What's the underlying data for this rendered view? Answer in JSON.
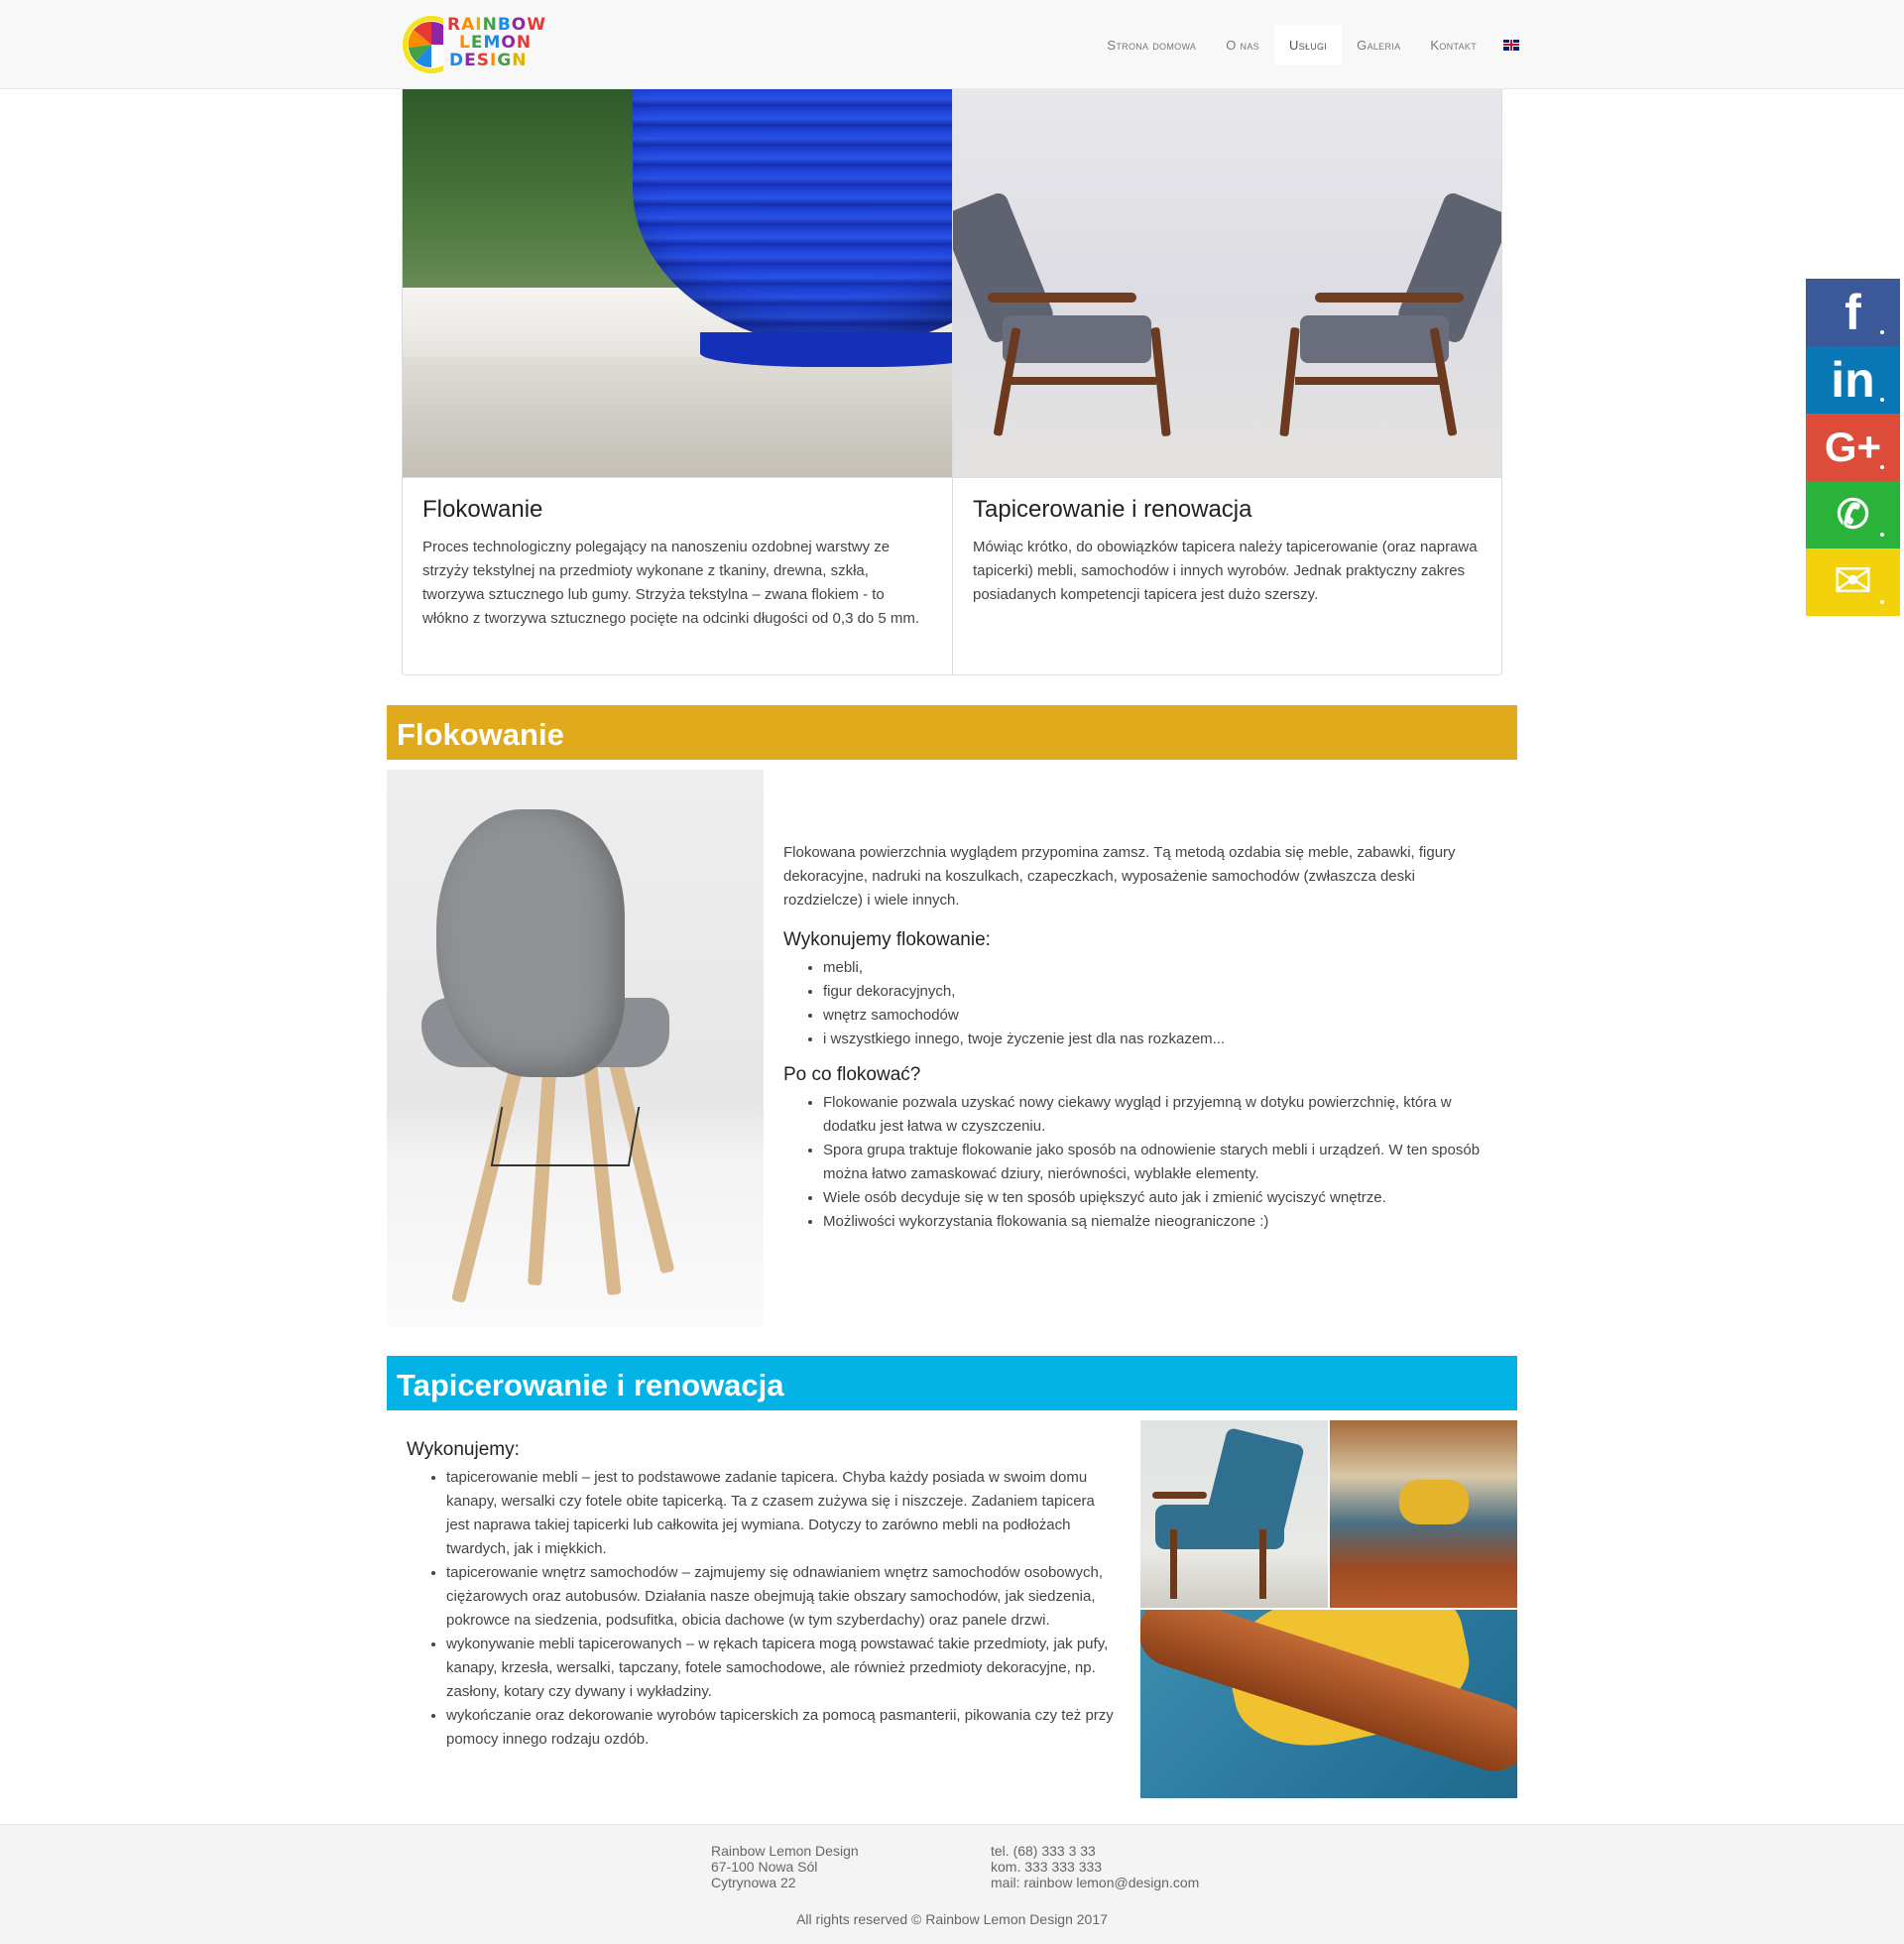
{
  "brand": {
    "line1": "RAINBOW",
    "line2": "LEMON",
    "line3": "DESIGN"
  },
  "nav": {
    "items": [
      {
        "label": "Strona domowa"
      },
      {
        "label": "O nas"
      },
      {
        "label": "Usługi"
      },
      {
        "label": "Galeria"
      },
      {
        "label": "Kontakt"
      }
    ],
    "active": "Usługi",
    "language_flag": "uk-flag-icon"
  },
  "cards": [
    {
      "title": "Flokowanie",
      "text": "Proces technologiczny polegający na nanoszeniu ozdobnej warstwy ze strzyży tekstylnej na przedmioty wykonane z tkaniny, drewna, szkła, tworzywa sztucznego lub gumy. Strzyża tekstylna – zwana flokiem - to włókno z tworzywa sztucznego pocięte na odcinki długości od 0,3 do 5 mm."
    },
    {
      "title": "Tapicerowanie i renowacja",
      "text": "Mówiąc krótko, do obowiązków tapicera należy tapicerowanie (oraz naprawa tapicerki) mebli, samochodów i innych wyrobów. Jednak praktyczny zakres posiadanych kompetencji tapicera jest dużo szerszy."
    }
  ],
  "flokowanie": {
    "heading": "Flokowanie",
    "intro": "Flokowana powierzchnia wyglądem przypomina zamsz. Tą metodą ozdabia się meble, zabawki, figury dekoracyjne, nadruki na koszulkach, czapeczkach, wyposażenie samochodów (zwłaszcza deski rozdzielcze) i wiele innych.",
    "wykonujemy_heading": "Wykonujemy flokowanie:",
    "wykonujemy_items": [
      "mebli,",
      "figur dekoracyjnych,",
      "wnętrz samochodów",
      "i wszystkiego innego, twoje życzenie jest dla nas rozkazem..."
    ],
    "poco_heading": "Po co flokować?",
    "poco_items": [
      "Flokowanie pozwala uzyskać nowy ciekawy wygląd i przyjemną w dotyku powierzchnię, która w dodatku jest łatwa w czyszczeniu.",
      "Spora grupa traktuje flokowanie jako sposób na odnowienie starych mebli i urządzeń. W ten sposób można łatwo zamaskować dziury, nierówności, wyblakłe elementy.",
      "Wiele osób decyduje się w ten sposób upiększyć auto jak i zmienić wyciszyć wnętrze.",
      "Możliwości wykorzystania flokowania są niemalże nieograniczone :)"
    ]
  },
  "tapicerowanie": {
    "heading": "Tapicerowanie i renowacja",
    "subheading": "Wykonujemy:",
    "items": [
      "tapicerowanie mebli – jest to podstawowe zadanie tapicera. Chyba każdy posiada w swoim domu kanapy, wersalki czy fotele obite tapicerką. Ta z czasem zużywa się i niszczeje. Zadaniem tapicera jest naprawa takiej tapicerki lub całkowita jej wymiana. Dotyczy to zarówno mebli na podłożach twardych, jak i miękkich.",
      "tapicerowanie wnętrz samochodów – zajmujemy się odnawianiem wnętrz samochodów osobowych, ciężarowych oraz autobusów. Działania nasze obejmują takie obszary samochodów, jak siedzenia, pokrowce na siedzenia, podsufitka, obicia dachowe (w tym szyberdachy) oraz panele drzwi.",
      "wykonywanie mebli tapicerowanych – w rękach tapicera mogą powstawać takie przedmioty, jak pufy, kanapy, krzesła, wersalki, tapczany, fotele samochodowe, ale również przedmioty dekoracyjne, np. zasłony, kotary czy dywany i wykładziny.",
      "wykończanie oraz dekorowanie wyrobów tapicerskich za pomocą pasmanterii, pikowania czy też przy pomocy innego rodzaju ozdób."
    ]
  },
  "social": [
    {
      "name": "facebook",
      "glyph": "f"
    },
    {
      "name": "linkedin",
      "glyph": "in"
    },
    {
      "name": "google-plus",
      "glyph": "G+"
    },
    {
      "name": "whatsapp",
      "glyph": "✆"
    },
    {
      "name": "email",
      "glyph": "✉"
    }
  ],
  "footer": {
    "company": "Rainbow Lemon Design",
    "address1": "67-100 Nowa Sól",
    "address2": "Cytrynowa 22",
    "tel": "tel. (68) 333 3 33",
    "kom": "kom. 333 333 333",
    "mail": "mail: rainbow lemon@design.com",
    "copyright": "All rights reserved © Rainbow Lemon Design 2017"
  },
  "colors": {
    "flokowanie_header": "#e0aa1c",
    "tapicerowanie_header": "#04b3e5",
    "facebook": "#3b5998",
    "linkedin": "#0a77b5",
    "google_plus": "#dd4b39",
    "whatsapp": "#2ab33a",
    "email": "#f3d20c"
  }
}
